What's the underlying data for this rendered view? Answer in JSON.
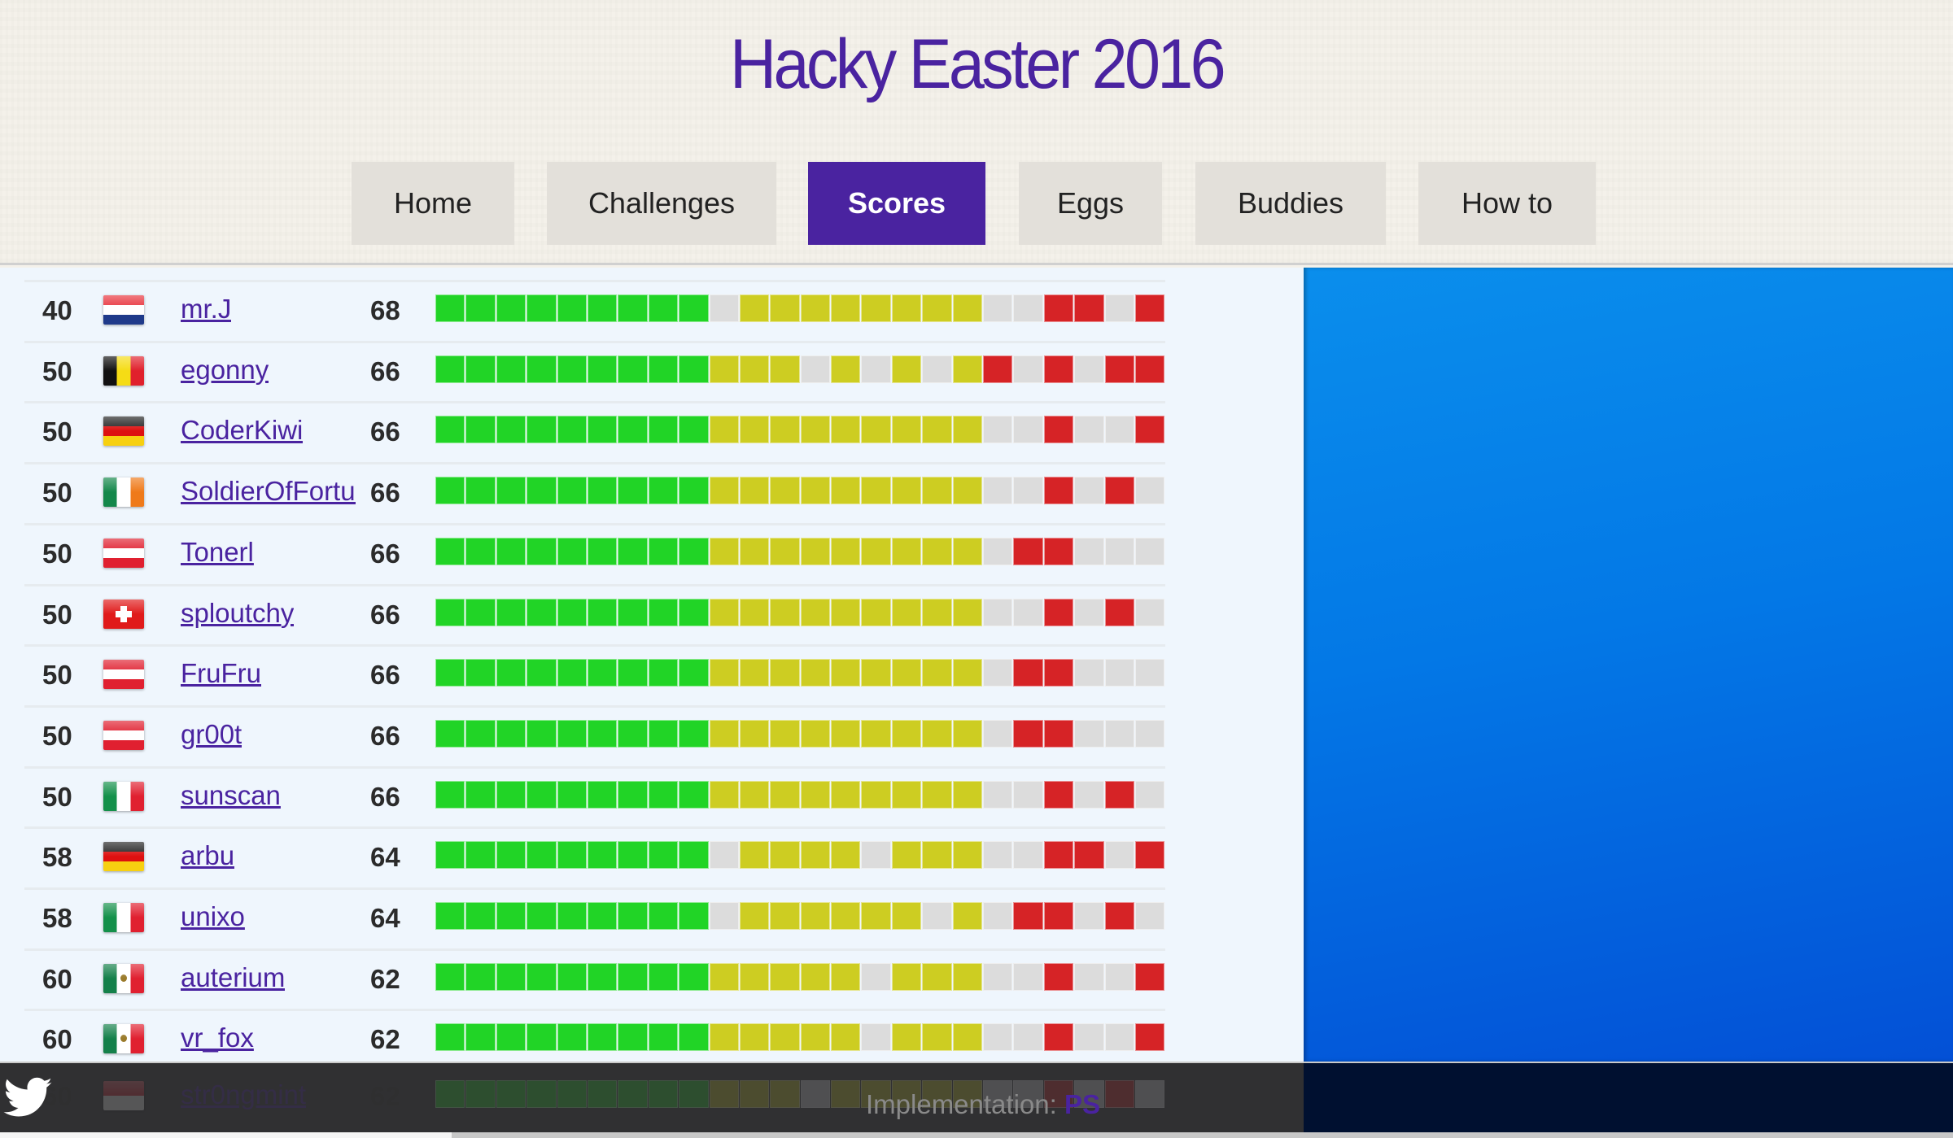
{
  "site": {
    "title": "Hacky Easter 2016"
  },
  "nav": {
    "items": [
      {
        "label": "Home",
        "active": false
      },
      {
        "label": "Challenges",
        "active": false
      },
      {
        "label": "Scores",
        "active": true
      },
      {
        "label": "Eggs",
        "active": false
      },
      {
        "label": "Buddies",
        "active": false
      },
      {
        "label": "How to",
        "active": false
      }
    ]
  },
  "colors": {
    "accent": "#4a23a0",
    "solved_easy": "#21d426",
    "solved_medium": "#cdcd22",
    "solved_hard": "#d62326",
    "unsolved": "#dcdcdc"
  },
  "legend_note": "Each row shows 24 challenge cells: 9 easy (green), 9 medium (yellow), 6 hard (red); 1 = solved, 0 = unsolved",
  "scores": [
    {
      "rank": "40",
      "country": "nl",
      "name": "mr.J",
      "points": "68",
      "cells": "111111111011111111001101"
    },
    {
      "rank": "50",
      "country": "be",
      "name": "egonny",
      "points": "66",
      "cells": "111111111111010101101011"
    },
    {
      "rank": "50",
      "country": "de",
      "name": "CoderKiwi",
      "points": "66",
      "cells": "111111111111111111001001"
    },
    {
      "rank": "50",
      "country": "ie",
      "name": "SoldierOfFortur",
      "points": "66",
      "cells": "111111111111111111001010"
    },
    {
      "rank": "50",
      "country": "at",
      "name": "Tonerl",
      "points": "66",
      "cells": "111111111111111111011000"
    },
    {
      "rank": "50",
      "country": "ch",
      "name": "sploutchy",
      "points": "66",
      "cells": "111111111111111111001010"
    },
    {
      "rank": "50",
      "country": "at",
      "name": "FruFru",
      "points": "66",
      "cells": "111111111111111111011000"
    },
    {
      "rank": "50",
      "country": "at",
      "name": "gr00t",
      "points": "66",
      "cells": "111111111111111111011000"
    },
    {
      "rank": "50",
      "country": "it",
      "name": "sunscan",
      "points": "66",
      "cells": "111111111111111111001010"
    },
    {
      "rank": "58",
      "country": "de",
      "name": "arbu",
      "points": "64",
      "cells": "111111111011110111001101"
    },
    {
      "rank": "58",
      "country": "it",
      "name": "unixo",
      "points": "64",
      "cells": "111111111011111101011010"
    },
    {
      "rank": "60",
      "country": "mx",
      "name": "auterium",
      "points": "62",
      "cells": "111111111111110111001001"
    },
    {
      "rank": "60",
      "country": "mx",
      "name": "vr_fox",
      "points": "62",
      "cells": "111111111111110111001001"
    },
    {
      "rank": "60",
      "country": "sg",
      "name": "str0ngmint",
      "points": "62",
      "cells": "111111111111011111001010"
    }
  ],
  "footer": {
    "implementation_label": "Implementation:",
    "implementation_value": "PS",
    "twitter_icon": "twitter-bird-icon"
  }
}
